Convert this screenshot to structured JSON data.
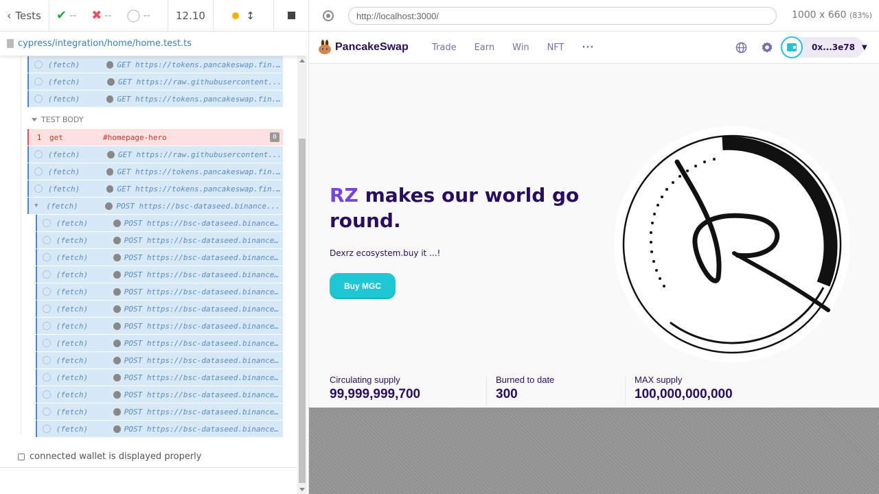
{
  "reporter": {
    "tests_label": "Tests",
    "passed": "--",
    "failed": "--",
    "pending": "--",
    "duration": "12.10",
    "spec_path": "cypress/integration/home/home.test.ts",
    "section_label": "TEST BODY",
    "pre_commands": [
      {
        "name": "(fetch)",
        "method": "GET",
        "url": "https://tokens.pancakeswap.fin..."
      },
      {
        "name": "(fetch)",
        "method": "GET",
        "url": "https://raw.githubusercontent..."
      },
      {
        "name": "(fetch)",
        "method": "GET",
        "url": "https://tokens.pancakeswap.fin..."
      }
    ],
    "failed_command": {
      "number": "1",
      "name": "get",
      "selector": "#homepage-hero",
      "badge": "0"
    },
    "body_commands": [
      {
        "name": "(fetch)",
        "method": "GET",
        "url": "https://raw.githubusercontent..."
      },
      {
        "name": "(fetch)",
        "method": "GET",
        "url": "https://tokens.pancakeswap.fin..."
      },
      {
        "name": "(fetch)",
        "method": "GET",
        "url": "https://tokens.pancakeswap.fin..."
      }
    ],
    "group_command": {
      "name": "(fetch)",
      "method": "POST",
      "url": "https://bsc-dataseed.binance..."
    },
    "nested_commands": [
      {
        "name": "(fetch)",
        "method": "POST",
        "url": "https://bsc-dataseed.binance..."
      },
      {
        "name": "(fetch)",
        "method": "POST",
        "url": "https://bsc-dataseed.binance..."
      },
      {
        "name": "(fetch)",
        "method": "POST",
        "url": "https://bsc-dataseed.binance..."
      },
      {
        "name": "(fetch)",
        "method": "POST",
        "url": "https://bsc-dataseed.binance..."
      },
      {
        "name": "(fetch)",
        "method": "POST",
        "url": "https://bsc-dataseed.binance..."
      },
      {
        "name": "(fetch)",
        "method": "POST",
        "url": "https://bsc-dataseed.binance..."
      },
      {
        "name": "(fetch)",
        "method": "POST",
        "url": "https://bsc-dataseed.binance..."
      },
      {
        "name": "(fetch)",
        "method": "POST",
        "url": "https://bsc-dataseed.binance..."
      },
      {
        "name": "(fetch)",
        "method": "POST",
        "url": "https://bsc-dataseed.binance..."
      },
      {
        "name": "(fetch)",
        "method": "POST",
        "url": "https://bsc-dataseed.binance..."
      },
      {
        "name": "(fetch)",
        "method": "POST",
        "url": "https://bsc-dataseed.binance..."
      },
      {
        "name": "(fetch)",
        "method": "POST",
        "url": "https://bsc-dataseed.binance..."
      },
      {
        "name": "(fetch)",
        "method": "POST",
        "url": "https://bsc-dataseed.binance..."
      }
    ],
    "test_title": "connected wallet is displayed properly"
  },
  "aut": {
    "url": "http://localhost:3000/",
    "viewport": "1000 x 660",
    "scale": "(83%)"
  },
  "app": {
    "brand": "PancakeSwap",
    "nav": [
      "Trade",
      "Earn",
      "Win",
      "NFT"
    ],
    "nav_more": "···",
    "wallet_address": "0x...3e78",
    "hero": {
      "title_accent": "RZ",
      "title_rest": " makes our world go round.",
      "subtitle": "Dexrz ecosystem.buy it ...!",
      "button": "Buy MGC"
    },
    "stats": [
      {
        "label": "Circulating supply",
        "value": "99,999,999,700"
      },
      {
        "label": "Burned to date",
        "value": "300"
      },
      {
        "label": "MAX supply",
        "value": "100,000,000,000"
      }
    ]
  },
  "colors": {
    "brand_dark": "#280d5f",
    "brand_accent": "#7645d9",
    "primary": "#1fc7d4",
    "cmd_bg": "#d7e8f7",
    "fail_bg": "#fde0e0"
  }
}
